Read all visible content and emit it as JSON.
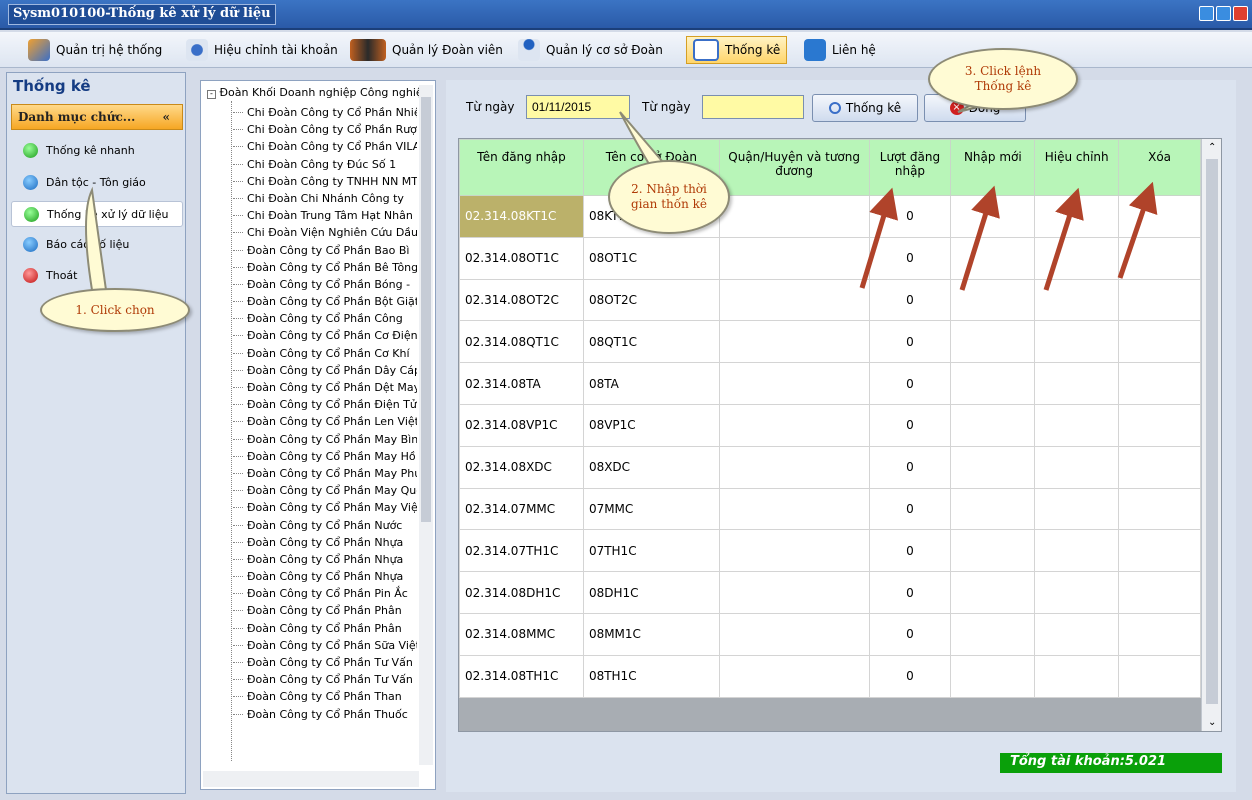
{
  "window": {
    "title": "Sysm010100-Thống kê xử lý dữ liệu"
  },
  "menu": [
    {
      "label": "Quản trị hệ thống",
      "icon": "wrench-icon"
    },
    {
      "label": "Hiệu chỉnh tài khoản",
      "icon": "user-edit-icon"
    },
    {
      "label": "Quản lý Đoàn viên",
      "icon": "users-icon"
    },
    {
      "label": "Quản lý cơ sở Đoàn",
      "icon": "network-icon"
    },
    {
      "label": "Thống kê",
      "icon": "table-icon",
      "active": true
    },
    {
      "label": "Liên hệ",
      "icon": "contact-icon"
    }
  ],
  "sidebar": {
    "title": "Thống kê",
    "category": "Danh mục chức...",
    "category_icon": "double-chevron-up-icon",
    "items": [
      {
        "label": "Thống kê nhanh",
        "color": "#22b022"
      },
      {
        "label": "Dân tộc - Tôn giáo",
        "color": "#1e8fe0"
      },
      {
        "label": "Thống kê xử lý dữ liệu",
        "color": "#22b022",
        "selected": true
      },
      {
        "label": "Báo cáo số liệu",
        "color": "#1e8fe0"
      },
      {
        "label": "Thoát",
        "color": "#e01818"
      }
    ]
  },
  "tree": {
    "root": "Đoàn Khối Doanh nghiệp Công nghiệp",
    "items": [
      "Chi Đoàn Công ty Cổ Phần Nhiệt",
      "Chi Đoàn Công ty Cổ Phần Rượu",
      "Chi Đoàn Công ty Cổ Phần VILACO",
      "Chi Đoàn Công ty Đúc Số 1",
      "Chi Đoàn Công ty TNHH NN MTV",
      "Chi Đoàn Chi Nhánh Công ty",
      "Chi Đoàn Trung Tâm Hạt Nhân",
      "Chi Đoàn Viện Nghiên Cứu Dầu",
      "Đoàn Công ty Cổ Phần Bao Bì",
      "Đoàn Công ty Cổ Phần Bê Tông",
      "Đoàn Công ty Cổ Phần Bóng -",
      "Đoàn Công ty Cổ Phần Bột Giặt",
      "Đoàn Công ty Cổ Phần Công",
      "Đoàn Công ty Cổ Phần Cơ Điện",
      "Đoàn Công ty Cổ Phần Cơ Khí",
      "Đoàn Công ty Cổ Phần Dây Cáp",
      "Đoàn Công ty Cổ Phần Dệt May",
      "Đoàn Công ty Cổ Phần Điện Tử",
      "Đoàn Công ty Cổ Phần Len Việt",
      "Đoàn Công ty Cổ Phần May Bình",
      "Đoàn Công ty Cổ Phần May Hồ",
      "Đoàn Công ty Cổ Phần May Phú",
      "Đoàn Công ty Cổ Phần May Quốc",
      "Đoàn Công ty Cổ Phần May Việt",
      "Đoàn Công ty Cổ Phần Nước",
      "Đoàn Công ty Cổ Phần Nhựa",
      "Đoàn Công ty Cổ Phần Nhựa",
      "Đoàn Công ty Cổ Phần Nhựa",
      "Đoàn Công ty Cổ Phần Pin Ắc",
      "Đoàn Công ty Cổ Phần Phân",
      "Đoàn Công ty Cổ Phần Phân",
      "Đoàn Công ty Cổ Phần Sữa Việt",
      "Đoàn Công ty Cổ Phần Tư Vấn",
      "Đoàn Công ty Cổ Phần Tư Vấn",
      "Đoàn Công ty Cổ Phần Than",
      "Đoàn Công ty Cổ Phần Thuốc"
    ]
  },
  "filter": {
    "from_label": "Từ ngày",
    "from_value": "01/11/2015",
    "to_label": "Từ ngày",
    "to_value": "",
    "stat_button": "Thống kê",
    "close_button": "Đóng"
  },
  "table": {
    "headers": [
      "Tên đăng nhập",
      "Tên cơ sở Đoàn",
      "Quận/Huyện và tương đương",
      "Lượt đăng nhập",
      "Nhập mới",
      "Hiệu chỉnh",
      "Xóa"
    ],
    "rows": [
      [
        "02.314.08KT1C",
        "08KT1C",
        "",
        "0",
        "",
        "",
        ""
      ],
      [
        "02.314.08OT1C",
        "08OT1C",
        "",
        "0",
        "",
        "",
        ""
      ],
      [
        "02.314.08OT2C",
        "08OT2C",
        "",
        "0",
        "",
        "",
        ""
      ],
      [
        "02.314.08QT1C",
        "08QT1C",
        "",
        "0",
        "",
        "",
        ""
      ],
      [
        "02.314.08TA",
        "08TA",
        "",
        "0",
        "",
        "",
        ""
      ],
      [
        "02.314.08VP1C",
        "08VP1C",
        "",
        "0",
        "",
        "",
        ""
      ],
      [
        "02.314.08XDC",
        "08XDC",
        "",
        "0",
        "",
        "",
        ""
      ],
      [
        "02.314.07MMC",
        "07MMC",
        "",
        "0",
        "",
        "",
        ""
      ],
      [
        "02.314.07TH1C",
        "07TH1C",
        "",
        "0",
        "",
        "",
        ""
      ],
      [
        "02.314.08DH1C",
        "08DH1C",
        "",
        "0",
        "",
        "",
        ""
      ],
      [
        "02.314.08MMC",
        "08MM1C",
        "",
        "0",
        "",
        "",
        ""
      ],
      [
        "02.314.08TH1C",
        "08TH1C",
        "",
        "0",
        "",
        "",
        ""
      ]
    ]
  },
  "total": "Tổng tài khoản:5.021",
  "callouts": {
    "step1": "1. Click chọn",
    "step2": "2. Nhập thời gian thốn kê",
    "step3": "3. Click lệnh Thống kê"
  },
  "colors": {
    "accent": "#ffd56a",
    "header_green": "#b8f5b8",
    "arrow": "#b0432a",
    "total_bg": "#0aa00a"
  }
}
